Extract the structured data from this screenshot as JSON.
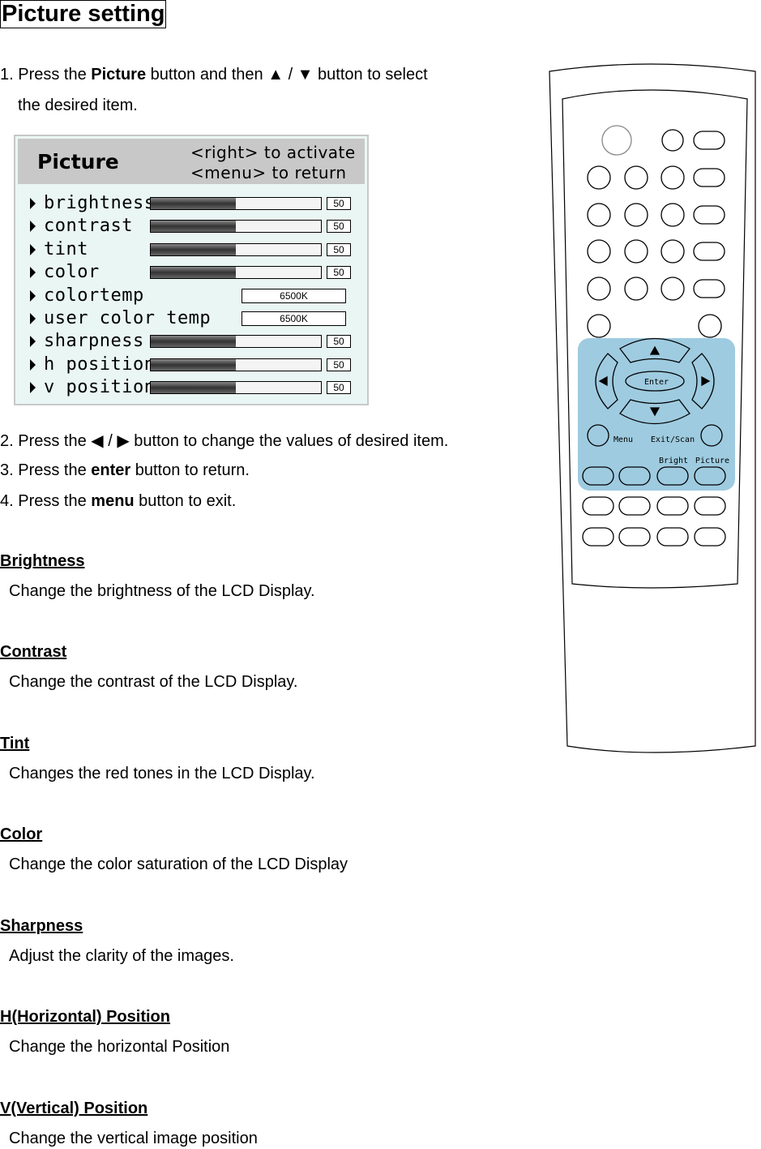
{
  "title": "Picture setting",
  "steps": {
    "s1a": "1. Press the ",
    "s1b": "Picture",
    "s1c": " button and then ▲ / ▼ button to select",
    "s1d": "the desired item.",
    "s2": "2. Press the ◀ / ▶ button to change the values of desired item.",
    "s3a": "3. Press the ",
    "s3b": "enter",
    "s3c": " button to return.",
    "s4a": "4. Press the ",
    "s4b": "menu",
    "s4c": " button to exit."
  },
  "osd": {
    "title": "Picture",
    "hint1": "<right> to activate",
    "hint2": "<menu> to return",
    "items": [
      {
        "label": "brightness",
        "type": "slider",
        "value": "50",
        "level": 50
      },
      {
        "label": "contrast",
        "type": "slider",
        "value": "50",
        "level": 50
      },
      {
        "label": "tint",
        "type": "slider",
        "value": "50",
        "level": 50
      },
      {
        "label": "color",
        "type": "slider",
        "value": "50",
        "level": 50
      },
      {
        "label": "colortemp",
        "type": "select",
        "value": "6500K"
      },
      {
        "label": "user color temp",
        "type": "select",
        "value": "6500K"
      },
      {
        "label": "sharpness",
        "type": "slider",
        "value": "50",
        "level": 50
      },
      {
        "label": "h position",
        "type": "slider",
        "value": "50",
        "level": 50
      },
      {
        "label": "v position",
        "type": "slider",
        "value": "50",
        "level": 50
      }
    ]
  },
  "sections": [
    {
      "heading": "Brightness",
      "text": "Change the brightness of the LCD Display."
    },
    {
      "heading": "Contrast",
      "text": "Change the contrast of the LCD Display."
    },
    {
      "heading": "Tint",
      "text": "Changes the red tones in the LCD Display."
    },
    {
      "heading": "Color",
      "text": "Change the color saturation of the LCD Display"
    },
    {
      "heading": "Sharpness",
      "text": "Adjust the clarity of the images."
    },
    {
      "heading": "H(Horizontal) Position",
      "text": "Change the horizontal Position"
    },
    {
      "heading": "V(Vertical) Position",
      "text": "Change the vertical image position"
    }
  ],
  "remote": {
    "enter": "Enter",
    "menu": "Menu",
    "exit": "Exit/Scan",
    "bright": "Bright",
    "picture": "Picture",
    "highlight_color": "#9ecbe0"
  }
}
